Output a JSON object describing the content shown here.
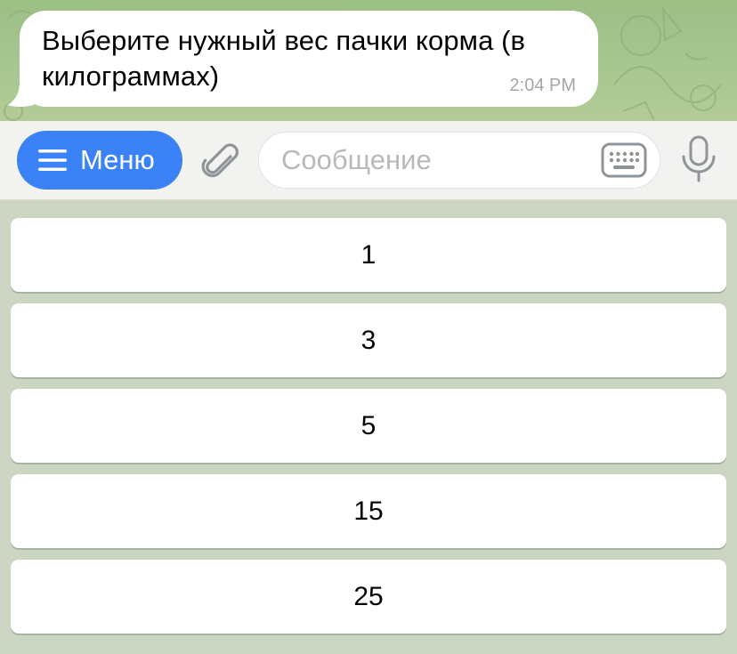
{
  "message": {
    "text": "Выберите нужный вес пачки корма (в килограммах)",
    "time": "2:04 PM"
  },
  "composer": {
    "menu_label": "Меню",
    "menu_icon": "hamburger-icon",
    "attach_icon": "paperclip-icon",
    "input_placeholder": "Сообщение",
    "keyboard_icon": "keyboard-icon",
    "mic_icon": "microphone-icon",
    "accent_color": "#3a82f6"
  },
  "reply_keyboard": {
    "buttons": [
      "1",
      "3",
      "5",
      "15",
      "25"
    ]
  }
}
